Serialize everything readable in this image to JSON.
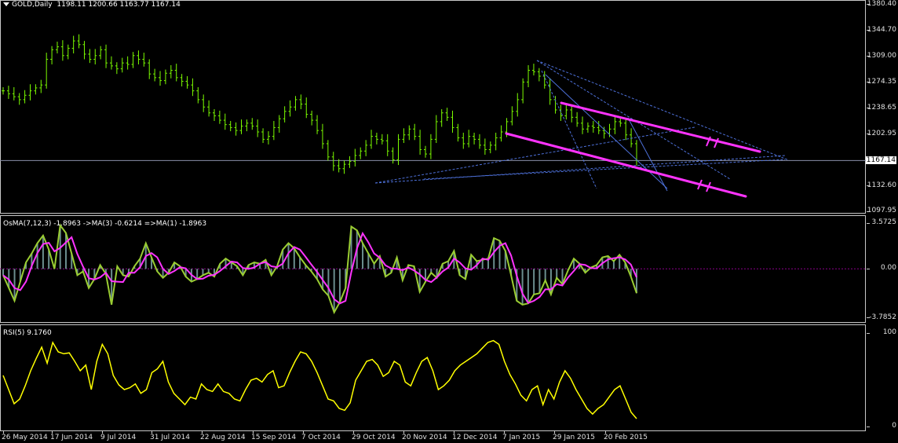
{
  "symbol_title": "GOLD,Daily",
  "ohlc": "1198.11 1200.66 1163.77 1167.14",
  "price_axis": {
    "ticks": [
      "1380.40",
      "1344.70",
      "1309.00",
      "1274.35",
      "1238.65",
      "1202.95",
      "1167.14",
      "1132.60",
      "1097.95"
    ],
    "current": "1167.14"
  },
  "osma": {
    "title": "OsMA(7,12,3) -1.8963 ->MA(3) -0.6214 =>MA(1) -1.8963",
    "ticks": [
      "3.5725",
      "0.00",
      "-3.7852"
    ]
  },
  "rsi": {
    "title": "RSI(5) 9.1760",
    "ticks": [
      "100",
      "0"
    ]
  },
  "dates": [
    "26 May 2014",
    "17 Jun 2014",
    "9 Jul 2014",
    "31 Jul 2014",
    "22 Aug 2014",
    "15 Sep 2014",
    "7 Oct 2014",
    "29 Oct 2014",
    "20 Nov 2014",
    "12 Dec 2014",
    "7 Jan 2015",
    "29 Jan 2015",
    "20 Feb 2015"
  ],
  "colors": {
    "background": "#000000",
    "bull_candle": "#7cfc00",
    "trendline": "#ff33ff",
    "fib_lines": "#4d70d9",
    "osma_histogram": "#6b8e8e",
    "osma_signal": "#9acd32",
    "osma_ma": "#ff33ff",
    "rsi": "#ffff00"
  },
  "chart_data": [
    {
      "type": "line",
      "series": [
        {
          "values": [
            1262,
            1258,
            1254,
            1250,
            1256,
            1262,
            1266,
            1270,
            1305,
            1318,
            1322,
            1310,
            1320,
            1330,
            1325,
            1312,
            1305,
            1310,
            1318,
            1300,
            1296,
            1292,
            1300,
            1298,
            1310,
            1305,
            1300,
            1285,
            1280,
            1276,
            1286,
            1290,
            1280,
            1275,
            1270,
            1262,
            1250,
            1240,
            1232,
            1228,
            1222,
            1216,
            1212,
            1208,
            1214,
            1218,
            1214,
            1206,
            1196,
            1200,
            1212,
            1224,
            1234,
            1240,
            1250,
            1244,
            1230,
            1222,
            1208,
            1190,
            1172,
            1160,
            1156,
            1162,
            1166,
            1174,
            1180,
            1188,
            1200,
            1196,
            1194,
            1180,
            1168,
            1196,
            1202,
            1210,
            1200,
            1182,
            1176,
            1196,
            1220,
            1232,
            1226,
            1212,
            1198,
            1190,
            1200,
            1196,
            1188,
            1182,
            1188,
            1198,
            1206,
            1220,
            1234,
            1250,
            1274,
            1290,
            1288,
            1282,
            1270,
            1250,
            1236,
            1228,
            1236,
            1226,
            1218,
            1210,
            1214,
            1212,
            1208,
            1204,
            1210,
            1220,
            1218,
            1202,
            1190,
            1167.14
          ]
        }
      ]
    },
    {
      "type": "bar",
      "series": [
        {
          "name": "OsMA",
          "values": [
            -0.5,
            -1.5,
            -2.5,
            -1.0,
            0.5,
            1.2,
            2.0,
            2.6,
            1.5,
            0.0,
            3.4,
            2.8,
            1.2,
            -0.5,
            -0.2,
            -1.5,
            -0.8,
            0.3,
            -0.4,
            -2.8,
            0.2,
            -0.5,
            -0.6,
            0.2,
            0.8,
            2.0,
            0.9,
            -0.2,
            -0.7,
            -0.3,
            0.5,
            0.2,
            -0.6,
            -1.0,
            -0.8,
            -0.5,
            -0.3,
            -0.6,
            0.4,
            0.8,
            0.5,
            0.2,
            -0.5,
            0.3,
            0.5,
            0.4,
            0.7,
            -0.5,
            0.2,
            1.5,
            2.0,
            1.6,
            0.9,
            0.3,
            -0.2,
            -0.8,
            -1.6,
            -2.1,
            -3.4,
            -2.6,
            -1.5,
            3.3,
            3.0,
            2.0,
            1.2,
            0.4,
            1.0,
            -0.6,
            -0.3,
            0.9,
            -0.9,
            0.3,
            0.2,
            -1.8,
            -1.0,
            -0.3,
            -0.7,
            0.4,
            0.6,
            1.4,
            -0.5,
            -0.8,
            1.1,
            0.6,
            0.7,
            0.8,
            2.4,
            2.2,
            1.4,
            -0.5,
            -2.5,
            -2.8,
            -2.7,
            -2.0,
            -1.9,
            -0.9,
            -2.0,
            -0.7,
            -1.2,
            -0.1,
            0.8,
            0.4,
            -0.3,
            0.1,
            0.3,
            0.9,
            1.0,
            0.6,
            1.1,
            0.5,
            -0.6,
            -1.9
          ]
        }
      ]
    },
    {
      "type": "line",
      "series": [
        {
          "name": "RSI",
          "values": [
            55,
            40,
            25,
            30,
            44,
            60,
            73,
            85,
            68,
            90,
            80,
            78,
            79,
            70,
            60,
            66,
            40,
            70,
            88,
            78,
            55,
            45,
            40,
            42,
            46,
            36,
            40,
            58,
            62,
            70,
            48,
            36,
            30,
            24,
            32,
            30,
            46,
            40,
            38,
            46,
            38,
            36,
            30,
            28,
            40,
            50,
            52,
            48,
            56,
            60,
            42,
            44,
            58,
            70,
            80,
            78,
            70,
            58,
            44,
            30,
            28,
            20,
            18,
            26,
            50,
            60,
            70,
            72,
            66,
            54,
            58,
            70,
            66,
            48,
            44,
            58,
            70,
            74,
            60,
            40,
            44,
            50,
            60,
            66,
            70,
            74,
            78,
            84,
            90,
            92,
            88,
            70,
            56,
            46,
            34,
            28,
            40,
            44,
            24,
            40,
            30,
            48,
            60,
            52,
            40,
            30,
            20,
            14,
            20,
            24,
            32,
            40,
            44,
            30,
            16,
            9.176
          ]
        }
      ],
      "ylim": [
        0,
        100
      ]
    }
  ]
}
